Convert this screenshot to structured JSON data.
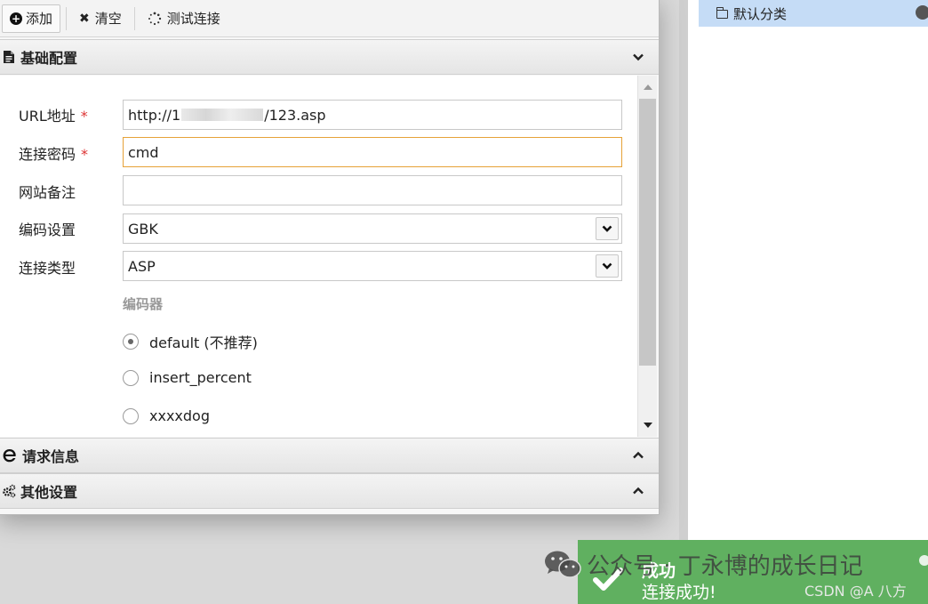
{
  "toolbar": {
    "add_label": "添加",
    "clear_label": "清空",
    "test_label": "测试连接"
  },
  "sections": {
    "basic": "基础配置",
    "request": "请求信息",
    "other": "其他设置"
  },
  "form": {
    "url": {
      "label": "URL地址",
      "required": "*",
      "value_prefix": "http://1",
      "value_suffix": "/123.asp"
    },
    "password": {
      "label": "连接密码",
      "required": "*",
      "value": "cmd"
    },
    "note": {
      "label": "网站备注",
      "value": ""
    },
    "encoding": {
      "label": "编码设置",
      "value": "GBK"
    },
    "conn_type": {
      "label": "连接类型",
      "value": "ASP"
    }
  },
  "encoder": {
    "title": "编码器",
    "options": [
      {
        "label": "default (不推荐)",
        "selected": true
      },
      {
        "label": "insert_percent",
        "selected": false
      },
      {
        "label": "xxxxdog",
        "selected": false
      }
    ]
  },
  "category": {
    "label": "默认分类"
  },
  "toast": {
    "title": "成功",
    "message": "连接成功!",
    "color": "#60b060"
  },
  "watermark": {
    "wechat_text": "公众号 · 丁永博的成长日记",
    "csdn_text": "CSDN @A  八方"
  },
  "colors": {
    "focus_border": "#e6a238",
    "required": "#dd3333",
    "category_bg": "#c5dcf6"
  }
}
